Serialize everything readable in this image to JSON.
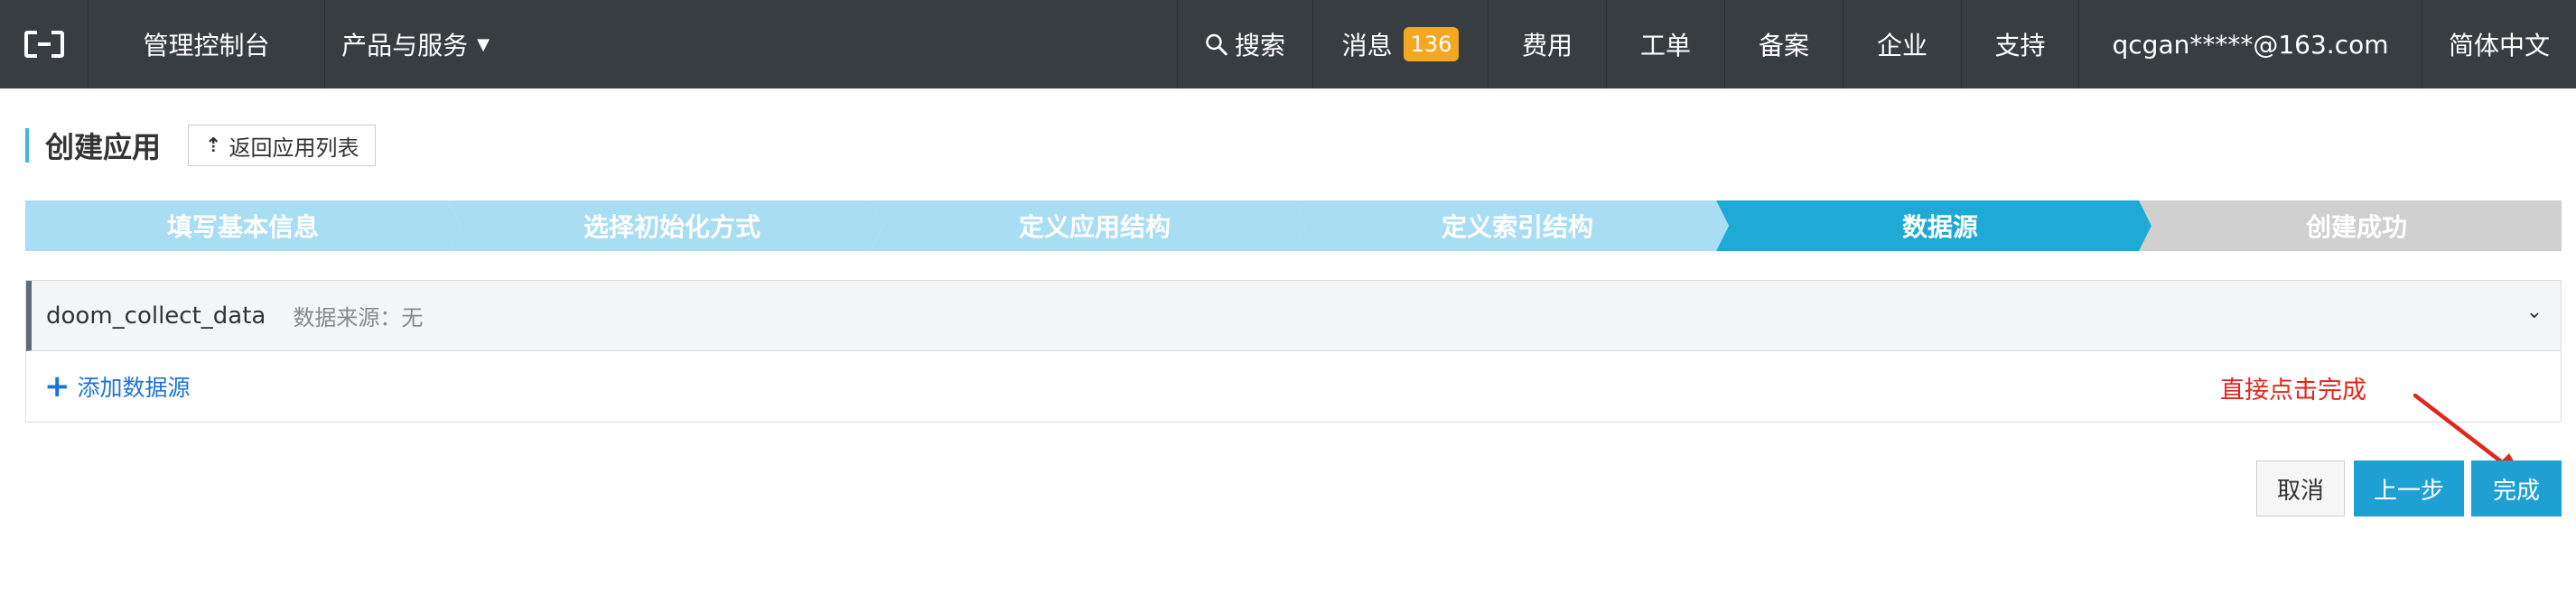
{
  "topbar": {
    "console": "管理控制台",
    "products": "产品与服务",
    "search": "搜索",
    "messages": "消息",
    "message_count": "136",
    "fees": "费用",
    "tickets": "工单",
    "beian": "备案",
    "enterprise": "企业",
    "support": "支持",
    "account": "qcgan*****@163.com",
    "language": "简体中文"
  },
  "page": {
    "title": "创建应用",
    "back_label": "返回应用列表"
  },
  "steps": [
    {
      "label": "填写基本信息",
      "state": "done"
    },
    {
      "label": "选择初始化方式",
      "state": "done"
    },
    {
      "label": "定义应用结构",
      "state": "done"
    },
    {
      "label": "定义索引结构",
      "state": "done"
    },
    {
      "label": "数据源",
      "state": "active"
    },
    {
      "label": "创建成功",
      "state": "todo"
    }
  ],
  "datasource": {
    "name": "doom_collect_data",
    "meta": "数据来源：无",
    "add_label": "添加数据源"
  },
  "annotation": "直接点击完成",
  "buttons": {
    "cancel": "取消",
    "prev": "上一步",
    "finish": "完成"
  },
  "colors": {
    "topbar": "#373d41",
    "step_done": "#a8ddf4",
    "step_active": "#1eaad4",
    "step_todo": "#d0d0d0",
    "primary": "#1ea0d2",
    "badge": "#f5a623",
    "annotation": "#e3251b",
    "link": "#1a73d9"
  },
  "icons": {
    "logo": "aliyun-logo-icon",
    "search": "search-icon",
    "caret": "caret-down-icon",
    "back": "upload-arrow-icon",
    "expand": "chevron-down-icon",
    "add": "plus-icon"
  }
}
